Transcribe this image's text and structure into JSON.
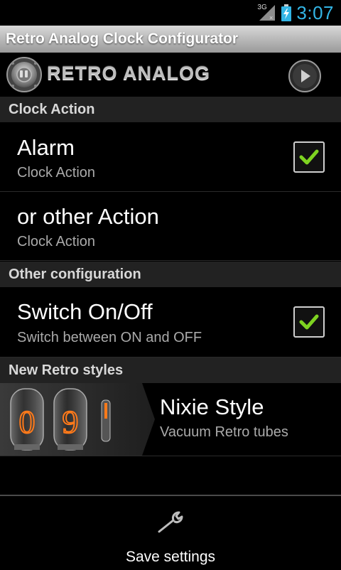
{
  "status_bar": {
    "network_label": "3G",
    "time": "3:07",
    "icons": [
      "signal-3g-icon",
      "battery-charging-icon"
    ]
  },
  "app": {
    "title": "Retro Analog Clock Configurator",
    "brand": "RETRO ANALOG",
    "icons": [
      "clock-logo-icon",
      "play-icon"
    ]
  },
  "sections": {
    "clock_action": "Clock Action",
    "other_configuration": "Other configuration",
    "new_retro_styles": "New Retro styles"
  },
  "rows": {
    "alarm": {
      "title": "Alarm",
      "subtitle": "Clock Action",
      "checked": true
    },
    "other_action": {
      "title": "or other Action",
      "subtitle": "Clock Action"
    },
    "switch": {
      "title": "Switch On/Off",
      "subtitle": "Switch between ON and OFF",
      "checked": true
    },
    "nixie": {
      "title": "Nixie Style",
      "subtitle": "Vacuum Retro tubes",
      "digits": [
        "0",
        "9"
      ]
    }
  },
  "bottom": {
    "save_label": "Save settings",
    "icon": "wrench-icon"
  },
  "colors": {
    "clock_accent": "#33b5e5",
    "check_green": "#7ed321",
    "section_bg": "#222222"
  }
}
